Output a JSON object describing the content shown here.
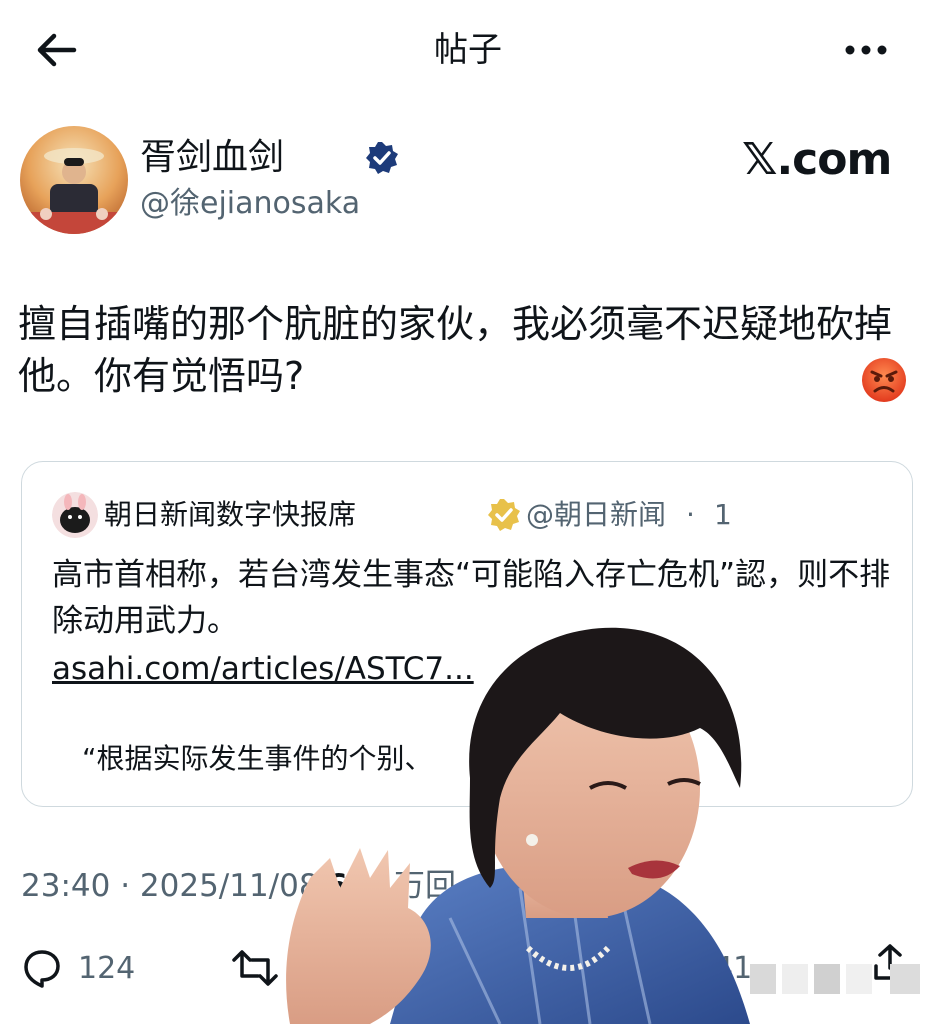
{
  "header": {
    "title": "帖子",
    "back_icon": "arrow-left-icon",
    "more_icon": "more-horizontal-icon"
  },
  "author": {
    "name": "胥剑血剑",
    "handle": "@徐ejianosaka",
    "verified_icon": "verified-badge-icon",
    "verified_color": "#1d3b7a"
  },
  "brand": "𝕏.com",
  "post": {
    "text": "擅自插嘴的那个肮脏的家伙，我必须毫不迟疑地砍掉他。你有觉悟吗?",
    "emoji_icon": "angry-face-icon"
  },
  "quote": {
    "name": "朝日新闻数字快报席",
    "handle": "@朝日新闻",
    "dot": "·",
    "time": "1",
    "text": "高市首相称，若台湾发生事态“可能陷入存亡危机”認，则不排除动用武力。",
    "link": "asahi.com/articles/ASTC7...",
    "excerpt": "“根据实际发生事件的个别、",
    "badge_color": "#e8c14a"
  },
  "meta": {
    "timestamp": "23:40 · 2025/11/08",
    "views_count": "6",
    "views_label": "万回"
  },
  "actions": {
    "reply_count": "124",
    "repost_count": "",
    "bookmark_count": "41"
  },
  "colors": {
    "text": "#0f1419",
    "secondary": "#536471",
    "border": "#cfd9de"
  }
}
